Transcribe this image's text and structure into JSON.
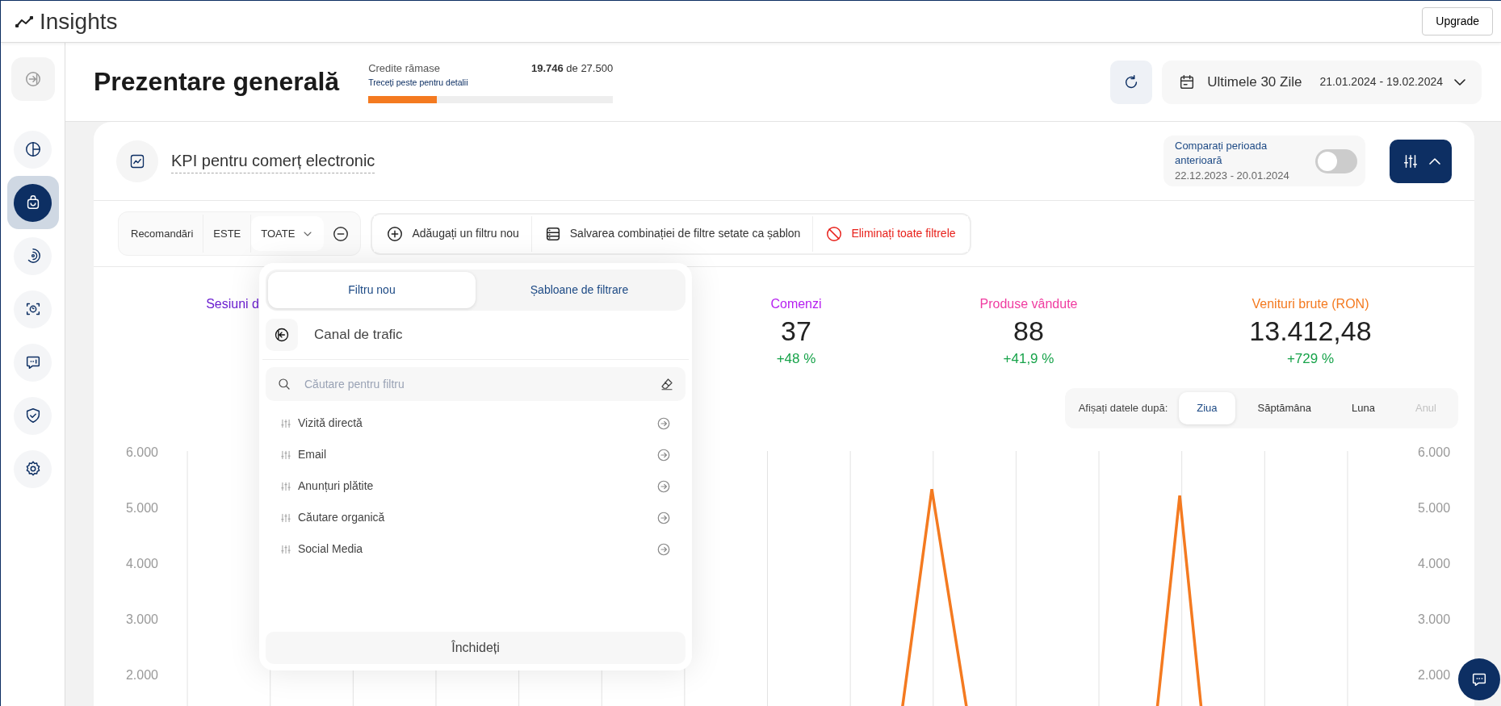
{
  "app": {
    "title": "Insights",
    "upgrade_button": "Upgrade"
  },
  "sidebar": {
    "items": [
      {
        "selected": false
      },
      {
        "selected": true
      },
      {
        "selected": false
      },
      {
        "selected": false
      },
      {
        "selected": false
      },
      {
        "selected": false
      },
      {
        "selected": false
      }
    ]
  },
  "header": {
    "title": "Prezentare generală",
    "credits": {
      "label": "Credite rămase",
      "hint": "Treceți peste pentru detalii",
      "amount": "**19.746** de 27.500",
      "level": 0.28
    },
    "date_range": {
      "label": "Ultimele 30 Zile",
      "range": "21.01.2024 - 19.02.2024"
    }
  },
  "card": {
    "title": "KPI pentru comerț electronic",
    "compare": {
      "label": "Comparați perioada anterioară",
      "range": "22.12.2023 - 20.01.2024",
      "on": false
    },
    "filter_panel_expanded": true,
    "filters": [
      {
        "field": "Recomandări",
        "operator": "ESTE",
        "value": "TOATE"
      }
    ],
    "actions": [
      {
        "kind": "add",
        "label": "Adăugați un filtru nou"
      },
      {
        "kind": "save",
        "label": "Salvarea combinației de filtre setate ca șablon"
      },
      {
        "kind": "clear",
        "label": "Eliminați toate filtrele"
      }
    ],
    "kpis": [
      {
        "label": "Sesiuni d",
        "color": "#6b1fd0"
      },
      {
        "label": "Comenzi",
        "value": "37",
        "change": "+48 %",
        "color": "#b620f0"
      },
      {
        "label": "Produse vândute",
        "value": "88",
        "change": "+41,9 %",
        "color": "#f03ca0"
      },
      {
        "label": "Venituri brute (RON)",
        "value": "13.412,48",
        "change": "+729 %",
        "color": "#f47a20"
      }
    ],
    "group_by": {
      "label": "Afișați datele după:",
      "options": [
        {
          "label": "Ziua",
          "selected": true,
          "disabled": false
        },
        {
          "label": "Săptămâna",
          "selected": false,
          "disabled": false
        },
        {
          "label": "Luna",
          "selected": false,
          "disabled": false
        },
        {
          "label": "Anul",
          "selected": false,
          "disabled": true
        }
      ]
    },
    "chart": {
      "left_axis": [
        "6.000",
        "5.000",
        "4.000",
        "3.000",
        "2.000"
      ],
      "right_axis": [
        "6.000",
        "5.000",
        "4.000",
        "3.000",
        "2.000"
      ]
    }
  },
  "filter_dropdown": {
    "tabs": [
      {
        "label": "Filtru nou",
        "selected": true
      },
      {
        "label": "Șabloane de filtrare",
        "selected": false
      }
    ],
    "category": "Canal de trafic",
    "search": {
      "placeholder": "Căutare pentru filtru"
    },
    "options": [
      "Vizită directă",
      "Email",
      "Anunțuri plătite",
      "Căutare organică",
      "Social Media"
    ],
    "close_button": "Închideți"
  }
}
